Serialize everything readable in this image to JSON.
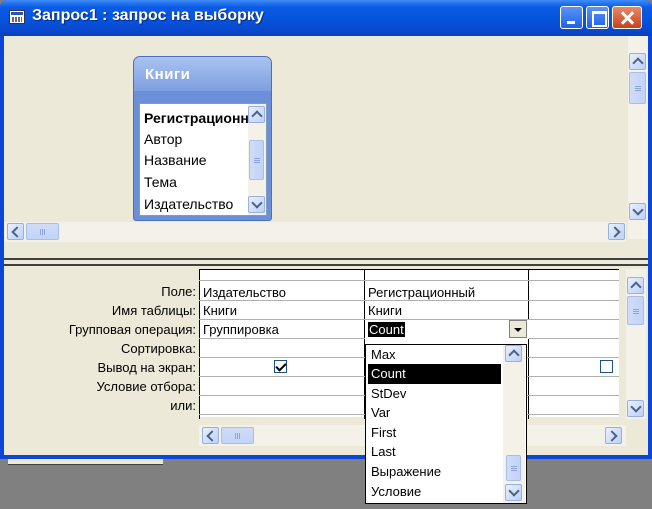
{
  "window": {
    "title": "Запрос1 : запрос на выборку"
  },
  "table": {
    "name": "Книги",
    "fields": [
      "Регистрационный",
      "Автор",
      "Название",
      "Тема",
      "Издательство"
    ]
  },
  "grid": {
    "row_labels": [
      "Поле:",
      "Имя таблицы:",
      "Групповая операция:",
      "Сортировка:",
      "Вывод на экран:",
      "Условие отбора:",
      "или:"
    ],
    "columns": [
      {
        "field": "Издательство",
        "table": "Книги",
        "group_op": "Группировка",
        "show": true
      },
      {
        "field": "Регистрационный",
        "table": "Книги",
        "group_op": "Count",
        "show": true
      },
      {
        "field": "",
        "table": "",
        "group_op": "",
        "show": false
      }
    ]
  },
  "dropdown": {
    "options": [
      "Max",
      "Count",
      "StDev",
      "Var",
      "First",
      "Last",
      "Выражение",
      "Условие"
    ],
    "selected": "Count"
  },
  "colors": {
    "title_bar": "#0a46d8",
    "client_bg": "#ece9d8",
    "close_button": "#c9411a"
  }
}
